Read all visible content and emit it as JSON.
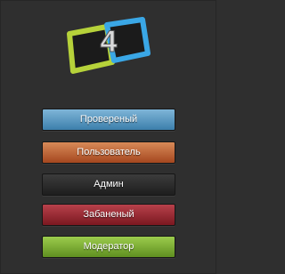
{
  "logo": {
    "character": "4",
    "colors": {
      "left_frame": "#b6d23a",
      "right_frame": "#3aa7e6",
      "digit": "#d9d9d9"
    }
  },
  "roles": [
    {
      "label": "Провереный",
      "color_top": "#7fb5d8",
      "color_bottom": "#3c7fab"
    },
    {
      "label": "Пользователь",
      "color_top": "#d88a58",
      "color_bottom": "#a5471f"
    },
    {
      "label": "Админ",
      "color_top": "#3c3c3c",
      "color_bottom": "#1e1e1e"
    },
    {
      "label": "Забаненый",
      "color_top": "#b8414b",
      "color_bottom": "#7a1820"
    },
    {
      "label": "Модератор",
      "color_top": "#9ccc4d",
      "color_bottom": "#5f8f20"
    }
  ]
}
